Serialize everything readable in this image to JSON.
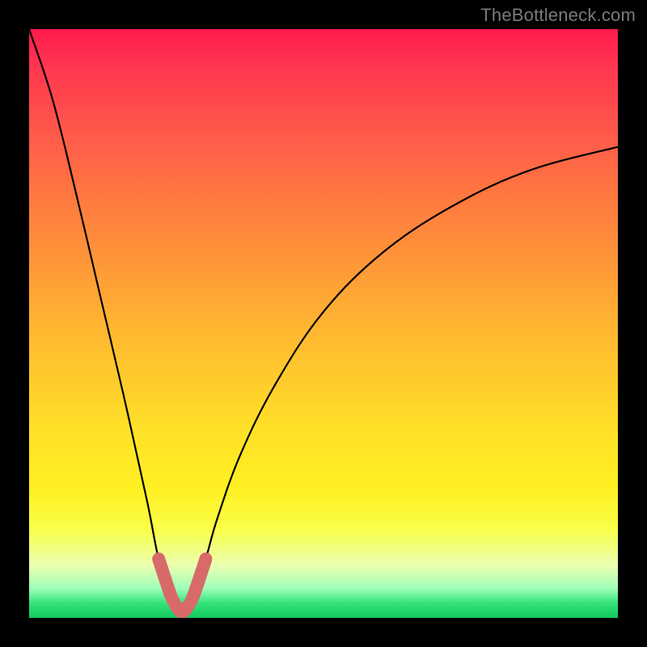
{
  "watermark": "TheBottleneck.com",
  "chart_data": {
    "type": "line",
    "title": "",
    "xlabel": "",
    "ylabel": "",
    "xlim": [
      0,
      100
    ],
    "ylim": [
      0,
      100
    ],
    "grid": false,
    "legend": false,
    "series": [
      {
        "name": "bottleneck-curve",
        "x": [
          0,
          4,
          8,
          12,
          16,
          20,
          22,
          24,
          25,
          26,
          27,
          28,
          30,
          32,
          36,
          42,
          50,
          60,
          72,
          85,
          100
        ],
        "values": [
          100,
          88,
          72,
          55,
          38,
          20,
          10,
          4,
          2,
          1,
          2,
          4,
          10,
          17,
          28,
          40,
          52,
          62,
          70,
          76,
          80
        ]
      },
      {
        "name": "highlighted-range",
        "x": [
          22,
          24,
          25,
          26,
          27,
          28,
          30
        ],
        "values": [
          10,
          4,
          2,
          1,
          2,
          4,
          10
        ]
      }
    ],
    "colors": {
      "curve": "#000000",
      "highlight": "#d86a6a",
      "gradient_top": "#ff1a4d",
      "gradient_bottom": "#12c95e"
    }
  }
}
